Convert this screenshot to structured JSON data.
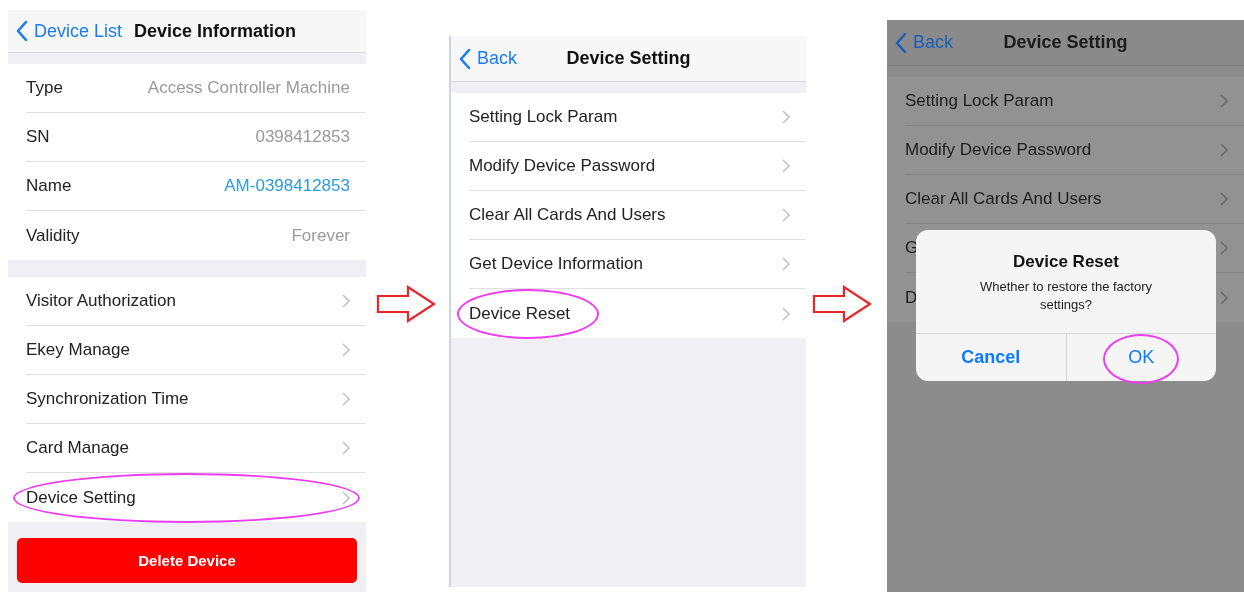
{
  "screens": [
    {
      "dimmed": false,
      "nav": {
        "back": "Device List",
        "title": "Device Information"
      },
      "groups": [
        [
          {
            "kind": "detail",
            "label": "Type",
            "value": "Access Controller Machine",
            "value_link": false,
            "highlighted": false
          },
          {
            "kind": "detail",
            "label": "SN",
            "value": "0398412853",
            "value_link": false,
            "highlighted": false
          },
          {
            "kind": "detail",
            "label": "Name",
            "value": "AM-0398412853",
            "value_link": true,
            "highlighted": false
          },
          {
            "kind": "detail",
            "label": "Validity",
            "value": "Forever",
            "value_link": false,
            "highlighted": false
          }
        ],
        [
          {
            "kind": "disclosure",
            "label": "Visitor Authorization",
            "highlighted": false
          },
          {
            "kind": "disclosure",
            "label": "Ekey Manage",
            "highlighted": false
          },
          {
            "kind": "disclosure",
            "label": "Synchronization Time",
            "highlighted": false
          },
          {
            "kind": "disclosure",
            "label": "Card Manage",
            "highlighted": false
          },
          {
            "kind": "disclosure",
            "label": "Device Setting",
            "highlighted": true
          }
        ]
      ],
      "delete_button": "Delete Device"
    },
    {
      "dimmed": false,
      "nav": {
        "back": "Back",
        "title": "Device Setting"
      },
      "groups": [
        [
          {
            "kind": "disclosure",
            "label": "Setting Lock Param",
            "highlighted": false
          },
          {
            "kind": "disclosure",
            "label": "Modify Device Password",
            "highlighted": false
          },
          {
            "kind": "disclosure",
            "label": "Clear All Cards And Users",
            "highlighted": false
          },
          {
            "kind": "disclosure",
            "label": "Get Device Information",
            "highlighted": false
          },
          {
            "kind": "disclosure",
            "label": "Device Reset",
            "highlighted": true
          }
        ]
      ]
    },
    {
      "dimmed": true,
      "nav": {
        "back": "Back",
        "title": "Device Setting"
      },
      "groups": [
        [
          {
            "kind": "disclosure",
            "label": "Setting Lock Param",
            "highlighted": false
          },
          {
            "kind": "disclosure",
            "label": "Modify Device Password",
            "highlighted": false
          },
          {
            "kind": "disclosure",
            "label": "Clear All Cards And Users",
            "highlighted": false
          },
          {
            "kind": "disclosure",
            "label": "G",
            "highlighted": false
          },
          {
            "kind": "disclosure",
            "label": "D",
            "highlighted": false
          }
        ]
      ],
      "dialog": {
        "title": "Device Reset",
        "message": "Whether to restore the factory settings?",
        "buttons": [
          {
            "label": "Cancel",
            "kind": "cancel",
            "highlighted": false
          },
          {
            "label": "OK",
            "kind": "default",
            "highlighted": true
          }
        ]
      }
    }
  ]
}
